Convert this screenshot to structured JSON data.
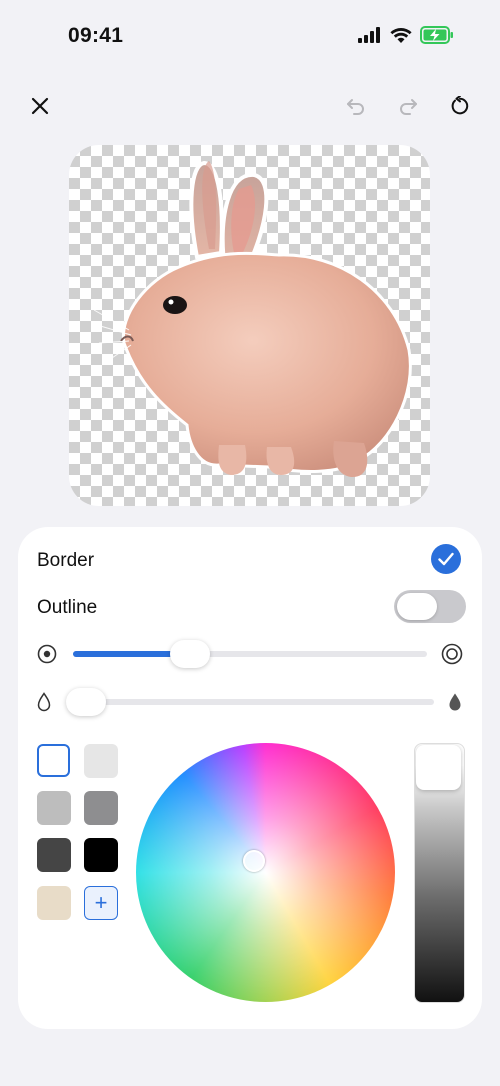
{
  "status_bar": {
    "time": "09:41"
  },
  "toolbar": {
    "close_icon": "close-icon",
    "undo_icon": "undo-icon",
    "redo_icon": "redo-icon",
    "reset_icon": "reset-icon"
  },
  "panel": {
    "border_label": "Border",
    "border_checked": true,
    "outline_label": "Outline",
    "outline_on": false,
    "size_slider": {
      "value": 0.33,
      "min_icon": "radio-dot-icon",
      "max_icon": "radio-rings-icon"
    },
    "softness_slider": {
      "value": 0.03,
      "min_icon": "drop-outline-icon",
      "max_icon": "drop-filled-icon"
    },
    "swatches": [
      {
        "name": "white",
        "color": "#ffffff",
        "selected": true
      },
      {
        "name": "light-gray",
        "color": "#e6e6e6",
        "selected": false
      },
      {
        "name": "gray",
        "color": "#bdbdbd",
        "selected": false
      },
      {
        "name": "dark-gray",
        "color": "#8e8e90",
        "selected": false
      },
      {
        "name": "charcoal",
        "color": "#454545",
        "selected": false
      },
      {
        "name": "black",
        "color": "#000000",
        "selected": false
      },
      {
        "name": "beige",
        "color": "#e8dcc8",
        "selected": false
      }
    ],
    "add_swatch_label": "+",
    "accent_color": "#2a6fdb"
  }
}
